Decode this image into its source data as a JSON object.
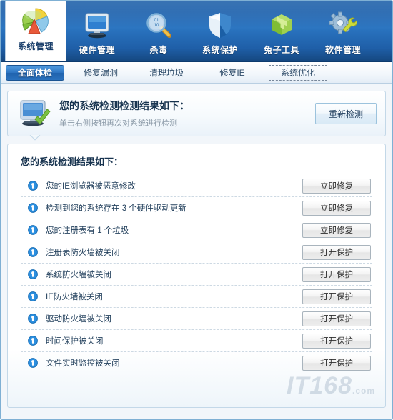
{
  "toolbar": {
    "items": [
      {
        "label": "系统管理",
        "icon": "pie-chart-icon",
        "active": true
      },
      {
        "label": "硬件管理",
        "icon": "monitor-icon",
        "active": false
      },
      {
        "label": "杀毒",
        "icon": "magnifier-icon",
        "active": false
      },
      {
        "label": "系统保护",
        "icon": "shield-icon",
        "active": false
      },
      {
        "label": "兔子工具",
        "icon": "green-box-icon",
        "active": false
      },
      {
        "label": "软件管理",
        "icon": "gear-wrench-icon",
        "active": false
      }
    ]
  },
  "tabs": [
    {
      "label": "全面体检",
      "state": "selected"
    },
    {
      "label": "修复漏洞",
      "state": "normal"
    },
    {
      "label": "清理垃圾",
      "state": "normal"
    },
    {
      "label": "修复IE",
      "state": "normal"
    },
    {
      "label": "系统优化",
      "state": "focused"
    }
  ],
  "banner": {
    "icon": "monitor-check-icon",
    "title": "您的系统检测检测结果如下：",
    "subtitle": "单击右侧按钮再次对系统进行检测",
    "rescan_label": "重新检测"
  },
  "panel": {
    "title": "您的系统检测结果如下：",
    "rows": [
      {
        "icon": "info-exclaim-icon",
        "text": "您的IE浏览器被恶意修改",
        "action": "立即修复"
      },
      {
        "icon": "info-exclaim-icon",
        "text": "检测到您的系统存在 3 个硬件驱动更新",
        "action": "立即修复"
      },
      {
        "icon": "info-exclaim-icon",
        "text": "您的注册表有 1 个垃圾",
        "action": "立即修复"
      },
      {
        "icon": "info-exclaim-icon",
        "text": "注册表防火墙被关闭",
        "action": "打开保护"
      },
      {
        "icon": "info-exclaim-icon",
        "text": "系统防火墙被关闭",
        "action": "打开保护"
      },
      {
        "icon": "info-exclaim-icon",
        "text": "IE防火墙被关闭",
        "action": "打开保护"
      },
      {
        "icon": "info-exclaim-icon",
        "text": "驱动防火墙被关闭",
        "action": "打开保护"
      },
      {
        "icon": "info-exclaim-icon",
        "text": "时间保护被关闭",
        "action": "打开保护"
      },
      {
        "icon": "info-exclaim-icon",
        "text": "文件实时监控被关闭",
        "action": "打开保护"
      }
    ]
  },
  "watermark": {
    "text": "IT168",
    "suffix": ".com"
  },
  "colors": {
    "header_blue": "#2a74c0",
    "header_blue_dark": "#15477f",
    "tab_selected": "#2e76c4",
    "panel_border": "#c3d8e8",
    "info_icon_blue": "#2b8fe0",
    "text_dark": "#17334f"
  }
}
